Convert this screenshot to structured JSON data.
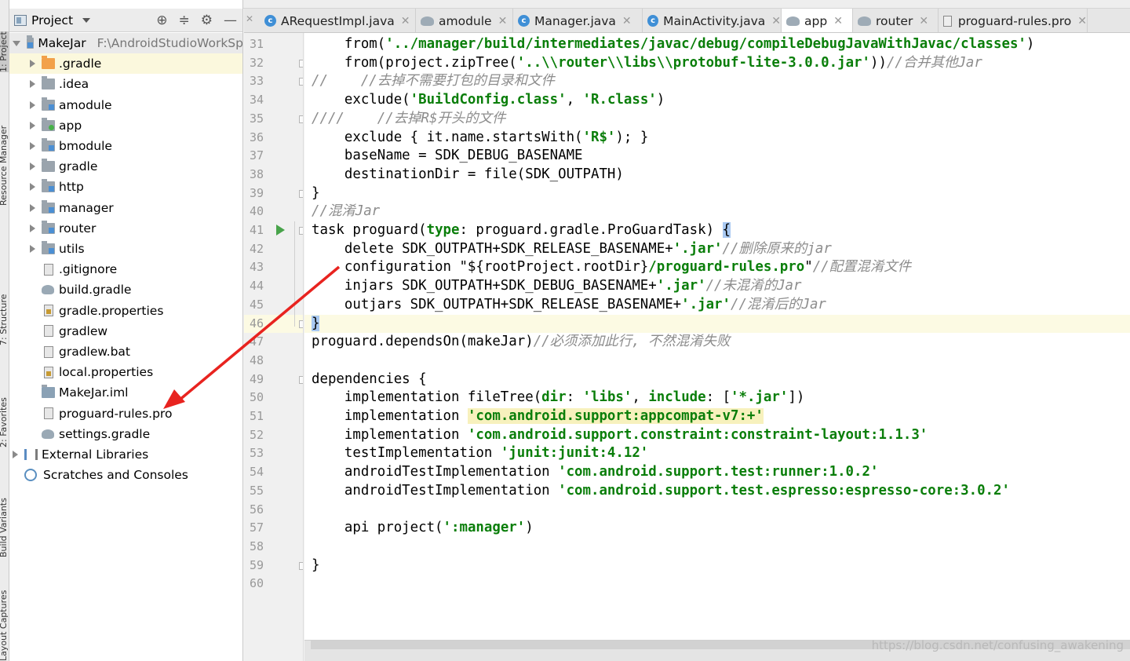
{
  "left_strip": {
    "tabs": [
      "1: Project",
      "Resource Manager",
      "7: Structure",
      "2: Favorites",
      "Build Variants",
      "Layout Captures"
    ]
  },
  "project_panel": {
    "title": "Project",
    "tools": [
      "⊕",
      "≑",
      "⚙",
      "—"
    ],
    "tree": [
      {
        "label": "MakeJar",
        "path": "F:\\AndroidStudioWorkSp",
        "kind": "root-module",
        "expanded": true,
        "indent": 0
      },
      {
        "label": ".gradle",
        "kind": "folder-orange",
        "indent": 1,
        "collapsible": true
      },
      {
        "label": ".idea",
        "kind": "folder",
        "indent": 1,
        "collapsible": true
      },
      {
        "label": "amodule",
        "kind": "module",
        "indent": 1,
        "collapsible": true
      },
      {
        "label": "app",
        "kind": "app-module",
        "indent": 1,
        "collapsible": true
      },
      {
        "label": "bmodule",
        "kind": "module",
        "indent": 1,
        "collapsible": true
      },
      {
        "label": "gradle",
        "kind": "folder",
        "indent": 1,
        "collapsible": true
      },
      {
        "label": "http",
        "kind": "module",
        "indent": 1,
        "collapsible": true
      },
      {
        "label": "manager",
        "kind": "module",
        "indent": 1,
        "collapsible": true
      },
      {
        "label": "router",
        "kind": "module",
        "indent": 1,
        "collapsible": true
      },
      {
        "label": "utils",
        "kind": "module",
        "indent": 1,
        "collapsible": true
      },
      {
        "label": ".gitignore",
        "kind": "file",
        "indent": 1
      },
      {
        "label": "build.gradle",
        "kind": "gradle",
        "indent": 1
      },
      {
        "label": "gradle.properties",
        "kind": "props",
        "indent": 1
      },
      {
        "label": "gradlew",
        "kind": "file",
        "indent": 1
      },
      {
        "label": "gradlew.bat",
        "kind": "file",
        "indent": 1
      },
      {
        "label": "local.properties",
        "kind": "props",
        "indent": 1
      },
      {
        "label": "MakeJar.iml",
        "kind": "iml",
        "indent": 1
      },
      {
        "label": "proguard-rules.pro",
        "kind": "file",
        "indent": 1
      },
      {
        "label": "settings.gradle",
        "kind": "gradle",
        "indent": 1
      },
      {
        "label": "External Libraries",
        "kind": "libs",
        "indent": 0,
        "collapsible": true
      },
      {
        "label": "Scratches and Consoles",
        "kind": "scratch",
        "indent": 0
      }
    ]
  },
  "editor_tabs": [
    {
      "label": "ARequestImpl.java",
      "icon": "class",
      "active": false
    },
    {
      "label": "amodule",
      "icon": "gradle",
      "active": false
    },
    {
      "label": "Manager.java",
      "icon": "class",
      "active": false
    },
    {
      "label": "MainActivity.java",
      "icon": "class",
      "active": false
    },
    {
      "label": "app",
      "icon": "gradle",
      "active": true
    },
    {
      "label": "router",
      "icon": "gradle",
      "active": false
    },
    {
      "label": "proguard-rules.pro",
      "icon": "file",
      "active": false
    }
  ],
  "editor": {
    "first_line": 31,
    "current_line": 46,
    "lines": [
      [
        [
          "    from(",
          ""
        ],
        [
          "'../manager/build/intermediates/javac/debug/compileDebugJavaWithJavac/classes'",
          "str"
        ],
        [
          ")",
          ""
        ]
      ],
      [
        [
          "    from(project.zipTree(",
          ""
        ],
        [
          "'..\\\\router\\\\libs\\\\protobuf-lite-3.0.0.jar'",
          "str"
        ],
        [
          "))",
          ""
        ],
        [
          "//合并其他Jar",
          "cmt"
        ]
      ],
      [
        [
          "//    //去掉不需要打包的目录和文件",
          "cmt"
        ]
      ],
      [
        [
          "    exclude(",
          ""
        ],
        [
          "'BuildConfig.class'",
          "str"
        ],
        [
          ", ",
          ""
        ],
        [
          "'R.class'",
          "str"
        ],
        [
          ")",
          ""
        ]
      ],
      [
        [
          "////    //去掉R$开头的文件",
          "cmt"
        ]
      ],
      [
        [
          "    exclude { it.name.startsWith(",
          ""
        ],
        [
          "'R$'",
          "str"
        ],
        [
          "); }",
          ""
        ]
      ],
      [
        [
          "    baseName = SDK_DEBUG_BASENAME",
          ""
        ]
      ],
      [
        [
          "    destinationDir = file(SDK_OUTPATH)",
          ""
        ]
      ],
      [
        [
          "}",
          ""
        ]
      ],
      [
        [
          "//混淆Jar",
          "cmt"
        ]
      ],
      [
        [
          "task proguard(",
          ""
        ],
        [
          "type",
          "kw"
        ],
        [
          ": proguard.gradle.ProGuardTask) ",
          ""
        ],
        [
          "{",
          "bracehl"
        ]
      ],
      [
        [
          "    delete SDK_OUTPATH+SDK_RELEASE_BASENAME+",
          ""
        ],
        [
          "'.jar'",
          "str"
        ],
        [
          "//删除原来的jar",
          "cmt"
        ]
      ],
      [
        [
          "    configuration \"${rootProject.rootDir}",
          ""
        ],
        [
          "/proguard-rules.pro",
          "str"
        ],
        [
          "\"",
          ""
        ],
        [
          "//配置混淆文件",
          "cmt"
        ]
      ],
      [
        [
          "    injars SDK_OUTPATH+SDK_DEBUG_BASENAME+",
          ""
        ],
        [
          "'.jar'",
          "str"
        ],
        [
          "//未混淆的Jar",
          "cmt"
        ]
      ],
      [
        [
          "    outjars SDK_OUTPATH+SDK_RELEASE_BASENAME+",
          ""
        ],
        [
          "'.jar'",
          "str"
        ],
        [
          "//混淆后的Jar",
          "cmt"
        ]
      ],
      [
        [
          "}",
          "bracehl"
        ]
      ],
      [
        [
          "proguard.dependsOn(makeJar)",
          ""
        ],
        [
          "//必须添加此行, 不然混淆失败",
          "cmt"
        ]
      ],
      [
        [
          "",
          ""
        ]
      ],
      [
        [
          "dependencies {",
          ""
        ]
      ],
      [
        [
          "    implementation fileTree(",
          ""
        ],
        [
          "dir",
          "kw"
        ],
        [
          ": ",
          ""
        ],
        [
          "'libs'",
          "str"
        ],
        [
          ", ",
          ""
        ],
        [
          "include",
          "kw"
        ],
        [
          ": [",
          ""
        ],
        [
          "'*.jar'",
          "str"
        ],
        [
          "])",
          ""
        ]
      ],
      [
        [
          "    implementation ",
          ""
        ],
        [
          "'com.android.support:appcompat-v7:+'",
          "str hlbg"
        ]
      ],
      [
        [
          "    implementation ",
          ""
        ],
        [
          "'com.android.support.constraint:constraint-layout:1.1.3'",
          "str"
        ]
      ],
      [
        [
          "    testImplementation ",
          ""
        ],
        [
          "'junit:junit:4.12'",
          "str"
        ]
      ],
      [
        [
          "    androidTestImplementation ",
          ""
        ],
        [
          "'com.android.support.test:runner:1.0.2'",
          "str"
        ]
      ],
      [
        [
          "    androidTestImplementation ",
          ""
        ],
        [
          "'com.android.support.test.espresso:espresso-core:3.0.2'",
          "str"
        ]
      ],
      [
        [
          "",
          ""
        ]
      ],
      [
        [
          "    api project(",
          ""
        ],
        [
          "':manager'",
          "str"
        ],
        [
          ")",
          ""
        ]
      ],
      [
        [
          "",
          ""
        ]
      ],
      [
        [
          "}",
          ""
        ]
      ],
      [
        [
          "",
          ""
        ]
      ]
    ],
    "fold_markers_at": [
      32,
      33,
      35,
      39,
      41,
      46,
      49,
      59
    ],
    "run_marker_at": 41
  },
  "watermark": "https://blog.csdn.net/confusing_awakening",
  "colors": {
    "string": "#0a7e0a",
    "comment": "#8c8c8c",
    "annotation_arrow": "#e8231f",
    "selected_row": "#fbf8dd",
    "current_line": "#fcfae3"
  }
}
